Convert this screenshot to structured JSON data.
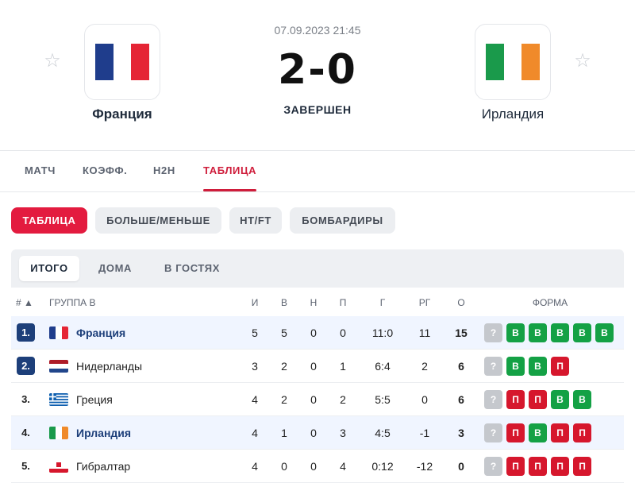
{
  "match": {
    "date": "07.09.2023 21:45",
    "score": "2-0",
    "status": "ЗАВЕРШЕН",
    "home": {
      "name": "Франция",
      "flag_colors": [
        "#1f3d8c",
        "#ffffff",
        "#e52535"
      ]
    },
    "away": {
      "name": "Ирландия",
      "flag_colors": [
        "#1a9a4b",
        "#ffffff",
        "#f08a2a"
      ]
    },
    "star_icon": "star-outline"
  },
  "tabs": [
    "МАТЧ",
    "КОЭФФ.",
    "H2H",
    "ТАБЛИЦА"
  ],
  "active_tab": "ТАБЛИЦА",
  "pills": [
    "ТАБЛИЦА",
    "БОЛЬШЕ/МЕНЬШЕ",
    "HT/FT",
    "БОМБАРДИРЫ"
  ],
  "subtabs": [
    "ИТОГО",
    "ДОМА",
    "В ГОСТЯХ"
  ],
  "table": {
    "headers": {
      "rank": "# ▲",
      "group": "ГРУППА B",
      "played": "И",
      "won": "В",
      "draw": "Н",
      "lost": "П",
      "goals": "Г",
      "diff": "РГ",
      "points": "О",
      "form": "ФОРМА"
    },
    "rows": [
      {
        "rank": "1.",
        "team": "Франция",
        "p": "5",
        "w": "5",
        "d": "0",
        "l": "0",
        "g": "11:0",
        "gd": "11",
        "pts": "15",
        "form": [
          "?",
          "В",
          "В",
          "В",
          "В",
          "В"
        ]
      },
      {
        "rank": "2.",
        "team": "Нидерланды",
        "p": "3",
        "w": "2",
        "d": "0",
        "l": "1",
        "g": "6:4",
        "gd": "2",
        "pts": "6",
        "form": [
          "?",
          "В",
          "В",
          "П"
        ]
      },
      {
        "rank": "3.",
        "team": "Греция",
        "p": "4",
        "w": "2",
        "d": "0",
        "l": "2",
        "g": "5:5",
        "gd": "0",
        "pts": "6",
        "form": [
          "?",
          "П",
          "П",
          "В",
          "В"
        ]
      },
      {
        "rank": "4.",
        "team": "Ирландия",
        "p": "4",
        "w": "1",
        "d": "0",
        "l": "3",
        "g": "4:5",
        "gd": "-1",
        "pts": "3",
        "form": [
          "?",
          "П",
          "В",
          "П",
          "П"
        ]
      },
      {
        "rank": "5.",
        "team": "Гибралтар",
        "p": "4",
        "w": "0",
        "d": "0",
        "l": "4",
        "g": "0:12",
        "gd": "-12",
        "pts": "0",
        "form": [
          "?",
          "П",
          "П",
          "П",
          "П"
        ]
      }
    ]
  },
  "colors": {
    "accent": "#e31b3f",
    "win": "#14a145",
    "loss": "#d6172d",
    "unknown": "#c5c8cd",
    "qualifier": "#1d3f7a"
  }
}
